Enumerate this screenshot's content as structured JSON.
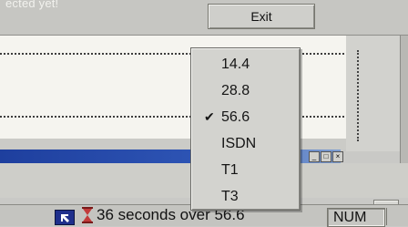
{
  "top": {
    "hint_text": "ected yet!",
    "exit_button_label": "Exit"
  },
  "window_controls": [
    "_",
    "□",
    "×"
  ],
  "speed_menu": {
    "items": [
      {
        "label": "14.4",
        "checked": false
      },
      {
        "label": "28.8",
        "checked": false
      },
      {
        "label": "56.6",
        "checked": true
      },
      {
        "label": "ISDN",
        "checked": false
      },
      {
        "label": "T1",
        "checked": false
      },
      {
        "label": "T3",
        "checked": false
      }
    ],
    "check_glyph": "✔"
  },
  "status_bar": {
    "message": "36 seconds over 56.6",
    "num_indicator": "NUM",
    "scroll_arrow": "▶"
  },
  "colors": {
    "titlebar": "#1e3f9e",
    "menu_bg": "#d3d3cf"
  }
}
